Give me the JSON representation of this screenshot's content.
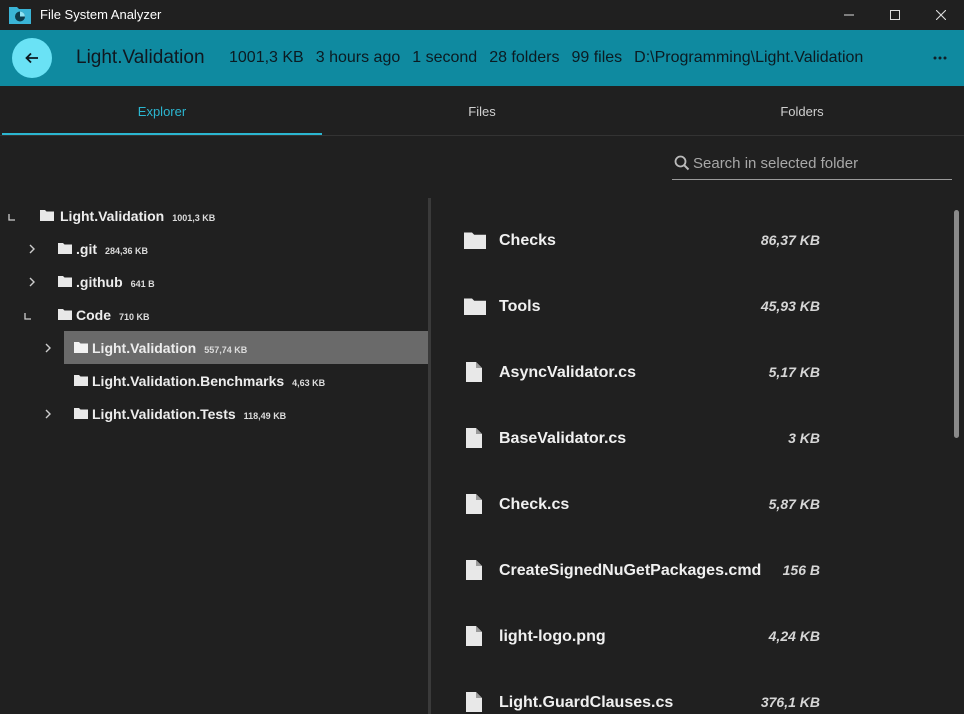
{
  "window": {
    "title": "File System Analyzer"
  },
  "header": {
    "title": "Light.Validation",
    "size": "1001,3 KB",
    "modified": "3 hours ago",
    "duration": "1 second",
    "folders": "28 folders",
    "files": "99 files",
    "path": "D:\\Programming\\Light.Validation"
  },
  "tabs": [
    {
      "label": "Explorer",
      "active": true
    },
    {
      "label": "Files",
      "active": false
    },
    {
      "label": "Folders",
      "active": false
    }
  ],
  "search": {
    "placeholder": "Search in selected folder"
  },
  "tree": [
    {
      "name": "Light.Validation",
      "size": "1001,3 KB",
      "state": "expanded",
      "selected": false
    },
    {
      "name": ".git",
      "size": "284,36 KB",
      "state": "collapsed",
      "selected": false
    },
    {
      "name": ".github",
      "size": "641 B",
      "state": "collapsed",
      "selected": false
    },
    {
      "name": "Code",
      "size": "710 KB",
      "state": "expanded",
      "selected": false
    },
    {
      "name": "Light.Validation",
      "size": "557,74 KB",
      "state": "collapsed",
      "selected": true
    },
    {
      "name": "Light.Validation.Benchmarks",
      "size": "4,63 KB",
      "state": "leaf",
      "selected": false
    },
    {
      "name": "Light.Validation.Tests",
      "size": "118,49 KB",
      "state": "collapsed",
      "selected": false
    }
  ],
  "items": [
    {
      "name": "Checks",
      "size": "86,37 KB",
      "icon": "folder-icon"
    },
    {
      "name": "Tools",
      "size": "45,93 KB",
      "icon": "folder-icon"
    },
    {
      "name": "AsyncValidator.cs",
      "size": "5,17 KB",
      "icon": "file-icon"
    },
    {
      "name": "BaseValidator.cs",
      "size": "3 KB",
      "icon": "file-icon"
    },
    {
      "name": "Check.cs",
      "size": "5,87 KB",
      "icon": "file-icon"
    },
    {
      "name": "CreateSignedNuGetPackages.cmd",
      "size": "156 B",
      "icon": "file-icon"
    },
    {
      "name": "light-logo.png",
      "size": "4,24 KB",
      "icon": "file-icon"
    },
    {
      "name": "Light.GuardClauses.cs",
      "size": "376,1 KB",
      "icon": "file-icon"
    }
  ],
  "colors": {
    "accent": "#0f8aa0",
    "fab": "#6ae2f5",
    "tab_active": "#2bb6d0",
    "selection": "#6a6a6a"
  }
}
